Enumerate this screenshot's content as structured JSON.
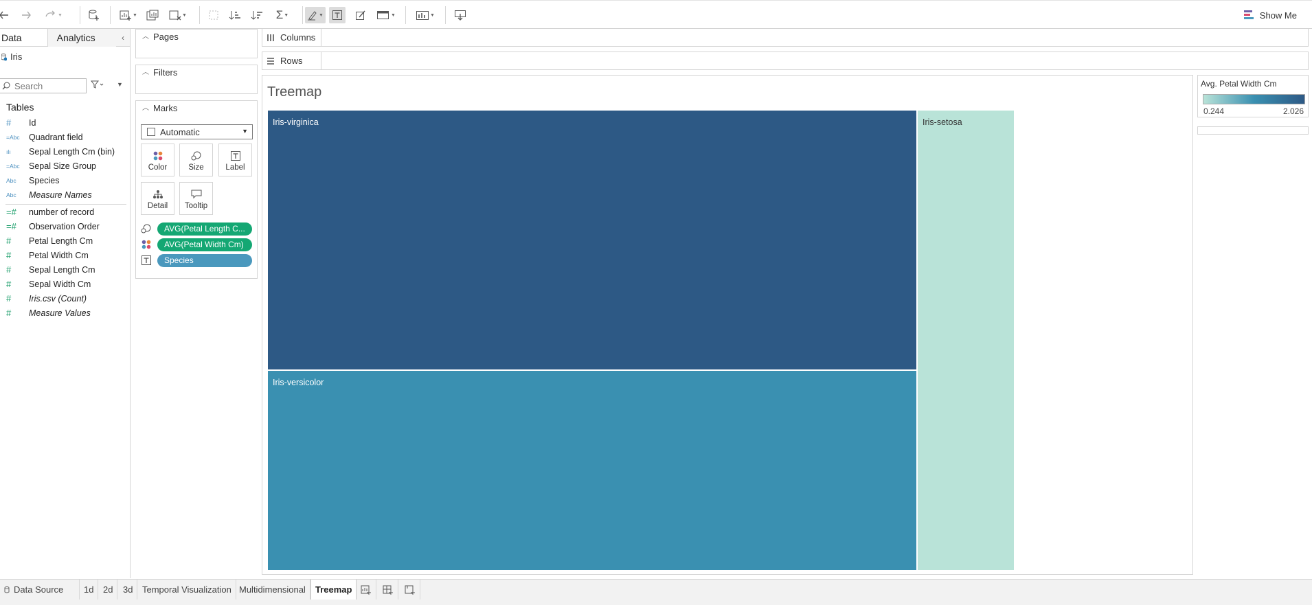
{
  "toolbar": {
    "show_me_label": "Show Me"
  },
  "datapane": {
    "tab_data": "Data",
    "tab_analytics": "Analytics",
    "source_name": "Iris",
    "search_placeholder": "Search",
    "tables_title": "Tables",
    "dimensions": [
      {
        "name": "Id",
        "icon": "#",
        "type": "measure-like"
      },
      {
        "name": "Quadrant field",
        "icon": "=Abc"
      },
      {
        "name": "Sepal Length Cm (bin)",
        "icon": "ılı"
      },
      {
        "name": "Sepal Size Group",
        "icon": "=Abc"
      },
      {
        "name": "Species",
        "icon": "Abc"
      },
      {
        "name": "Measure Names",
        "icon": "Abc"
      }
    ],
    "measures": [
      {
        "name": "number of record",
        "icon": "=#"
      },
      {
        "name": "Observation Order",
        "icon": "=#"
      },
      {
        "name": "Petal Length Cm",
        "icon": "#"
      },
      {
        "name": "Petal Width Cm",
        "icon": "#"
      },
      {
        "name": "Sepal Length Cm",
        "icon": "#"
      },
      {
        "name": "Sepal Width Cm",
        "icon": "#"
      },
      {
        "name": "Iris.csv (Count)",
        "icon": "#"
      },
      {
        "name": "Measure Values",
        "icon": "#"
      }
    ]
  },
  "cards": {
    "pages_title": "Pages",
    "filters_title": "Filters",
    "marks_title": "Marks",
    "mark_type": "Automatic",
    "buttons": {
      "color": "Color",
      "size": "Size",
      "label": "Label",
      "detail": "Detail",
      "tooltip": "Tooltip"
    },
    "pills": [
      {
        "encoding": "size",
        "text": "AVG(Petal Length C..."
      },
      {
        "encoding": "color",
        "text": "AVG(Petal Width Cm)"
      },
      {
        "encoding": "label",
        "text": "Species"
      }
    ]
  },
  "shelves": {
    "columns_label": "Columns",
    "rows_label": "Rows"
  },
  "view": {
    "title": "Treemap"
  },
  "chart_data": {
    "type": "treemap",
    "size_measure": "AVG(Petal Length Cm)",
    "color_measure": "AVG(Petal Width Cm)",
    "label_field": "Species",
    "items": [
      {
        "label": "Iris-virginica",
        "color": "#2d5985"
      },
      {
        "label": "Iris-versicolor",
        "color": "#3a90b1"
      },
      {
        "label": "Iris-setosa",
        "color": "#b9e3d8"
      }
    ]
  },
  "legend": {
    "title": "Avg. Petal Width Cm",
    "min": "0.244",
    "max": "2.026",
    "color_min": "#b9e3d8",
    "color_mid": "#3a90b1",
    "color_max": "#2d5985"
  },
  "sheets": {
    "data_source": "Data Source",
    "tabs": [
      "1d",
      "2d",
      "3d",
      "Temporal Visualization",
      "Multidimensional",
      "Treemap"
    ],
    "active": "Treemap"
  }
}
